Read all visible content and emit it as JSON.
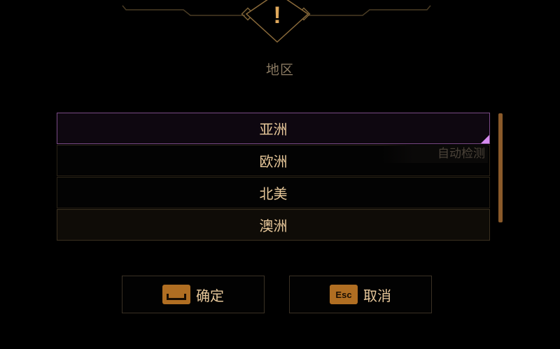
{
  "dialog": {
    "title": "地区",
    "warning_glyph": "!",
    "auto_detect_label": "自动检测"
  },
  "regions": [
    {
      "label": "亚洲",
      "state": "selected"
    },
    {
      "label": "欧洲",
      "state": "normal"
    },
    {
      "label": "北美",
      "state": "normal"
    },
    {
      "label": "澳洲",
      "state": "hover"
    }
  ],
  "buttons": {
    "confirm": {
      "label": "确定",
      "key_icon": "space-key-icon"
    },
    "cancel": {
      "label": "取消",
      "key_label": "Esc",
      "key_icon": "esc-key-icon"
    }
  },
  "colors": {
    "accent_gold": "#e0a95c",
    "selection_purple": "#d68bf0",
    "key_orange": "#b06e22"
  }
}
